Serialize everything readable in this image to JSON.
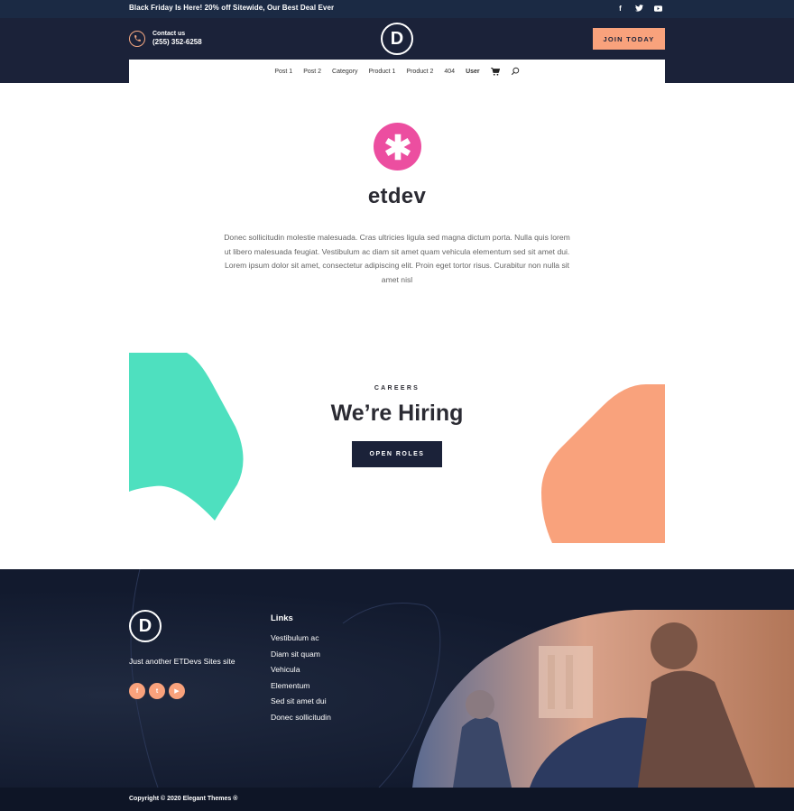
{
  "topbar": {
    "promo": "Black Friday Is Here! 20% off Sitewide, Our Best Deal Ever",
    "social_icons": [
      "facebook-icon",
      "twitter-icon",
      "youtube-icon"
    ]
  },
  "header": {
    "contact_label": "Contact us",
    "contact_phone": "(255) 352-6258",
    "logo_letter": "D",
    "join_label": "JOIN TODAY"
  },
  "nav": {
    "items": [
      "Post 1",
      "Post 2",
      "Category",
      "Product 1",
      "Product 2",
      "404",
      "User"
    ]
  },
  "hero": {
    "badge_icon": "asterisk-icon",
    "badge_glyph": "*",
    "title": "etdev",
    "text": "Donec sollicitudin molestie malesuada. Cras ultricies ligula sed magna dictum porta. Nulla quis lorem ut libero malesuada feugiat. Vestibulum ac diam sit amet quam vehicula elementum sed sit amet dui. Lorem ipsum dolor sit amet, consectetur adipiscing elit. Proin eget tortor risus. Curabitur non nulla sit amet nisl"
  },
  "careers": {
    "label": "CAREERS",
    "title": "We’re Hiring",
    "button": "OPEN ROLES"
  },
  "footer": {
    "logo_letter": "D",
    "tagline": "Just another ETDevs Sites site",
    "social_labels": [
      "f",
      "t",
      "▶"
    ],
    "links_title": "Links",
    "links": [
      "Vestibulum ac",
      "Diam sit quam",
      "Vehicula",
      "Elementum",
      "Sed sit amet dui",
      "Donec sollicitudin"
    ],
    "copyright": "Copyright © 2020 Elegant Themes ®"
  },
  "colors": {
    "dark_navy": "#1b2239",
    "topbar": "#1b2a44",
    "accent_orange": "#f9a27c",
    "accent_pink": "#ec4ea0",
    "accent_green": "#4ee0bf"
  }
}
